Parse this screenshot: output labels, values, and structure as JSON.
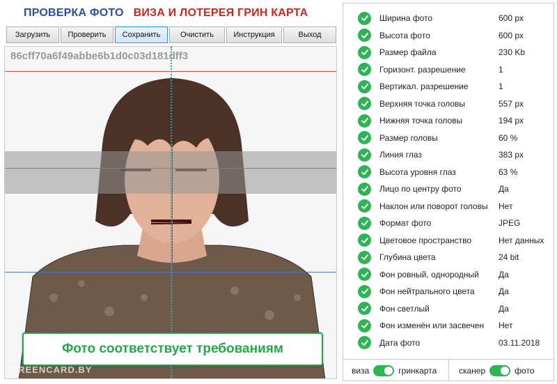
{
  "header": {
    "title_part1": "ПРОВЕРКА ФОТО",
    "title_part2": "ВИЗА И ЛОТЕРЕЯ ГРИН КАРТА"
  },
  "toolbar": {
    "buttons": [
      {
        "label": "Загрузить"
      },
      {
        "label": "Проверить"
      },
      {
        "label": "Сохранить",
        "active": true
      },
      {
        "label": "Очистить"
      },
      {
        "label": "Инструкция"
      },
      {
        "label": "Выход"
      }
    ]
  },
  "viewer": {
    "hash": "86cff70a6f49abbe6b1d0c03d181dff3",
    "status_message": "Фото соответствует требованиям",
    "watermark": "GREENCARD.BY"
  },
  "checks": [
    {
      "label": "Ширина фото",
      "value": "600 px"
    },
    {
      "label": "Высота фото",
      "value": "600 px"
    },
    {
      "label": "Размер файла",
      "value": "230 Kb"
    },
    {
      "label": "Горизонт. разрешение",
      "value": "1"
    },
    {
      "label": "Вертикал. разрешение",
      "value": "1"
    },
    {
      "label": "Верхняя точка головы",
      "value": "557 px"
    },
    {
      "label": "Нижняя точка головы",
      "value": "194 px"
    },
    {
      "label": "Размер головы",
      "value": "60 %"
    },
    {
      "label": "Линия глаз",
      "value": "383 px"
    },
    {
      "label": "Высота уровня глаз",
      "value": "63 %"
    },
    {
      "label": "Лицо по центру фото",
      "value": "Да"
    },
    {
      "label": "Наклон или поворот головы",
      "value": "Нет"
    },
    {
      "label": "Формат фото",
      "value": "JPEG"
    },
    {
      "label": "Цветовое пространство",
      "value": "Нет данных"
    },
    {
      "label": "Глубина цвета",
      "value": "24 bit"
    },
    {
      "label": "Фон ровный, однородный",
      "value": "Да"
    },
    {
      "label": "Фон нейтрального цвета",
      "value": "Да"
    },
    {
      "label": "Фон светлый",
      "value": "Да"
    },
    {
      "label": "Фон изменён или засвечен",
      "value": "Нет"
    },
    {
      "label": "Дата фото",
      "value": "03.11.2018"
    }
  ],
  "switches": {
    "left_off": "виза",
    "left_on": "гринкарта",
    "right_off": "сканер",
    "right_on": "фото"
  },
  "colors": {
    "accent_green": "#2fb455",
    "title_blue": "#2a4f9c",
    "title_red": "#c8281e"
  }
}
